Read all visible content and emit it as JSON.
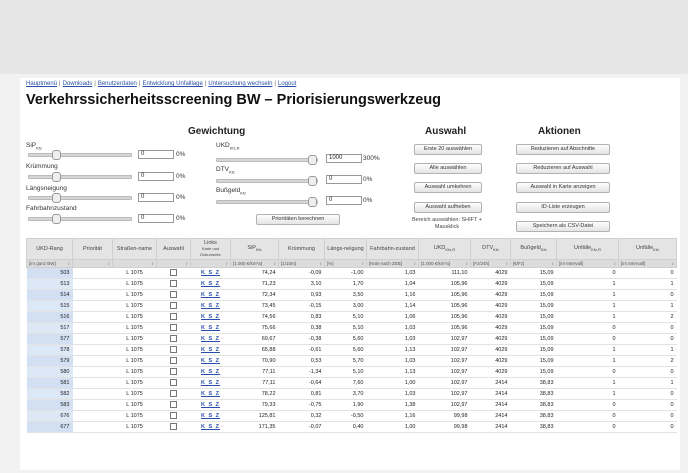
{
  "nav": [
    "Hauptmenü",
    "Downloads",
    "Benutzerdaten",
    "Entwicklung Unfalllage",
    "Untersuchung wechseln",
    "Logout"
  ],
  "title": "Verkehrssicherheitsscreening BW – Priorisierungswerkzeug",
  "gewichtung": {
    "heading": "Gewichtung",
    "items": [
      {
        "label": "SiP",
        "sub": "Kfz",
        "value": "0",
        "pct": "0%",
        "level": 0.0
      },
      {
        "label": "Krümmung",
        "sub": "",
        "value": "0",
        "pct": "0%",
        "level": 0.0
      },
      {
        "label": "Längsneigung",
        "sub": "",
        "value": "0",
        "pct": "0%",
        "level": 0.0
      },
      {
        "label": "Fahrbahnzustand",
        "sub": "",
        "value": "0",
        "pct": "0%",
        "level": 0.0
      },
      {
        "label": "UKD",
        "sub": "Kfz,R",
        "value": "1000",
        "pct": "300%",
        "level": 1.0
      },
      {
        "label": "DTV",
        "sub": "Kfz",
        "value": "0",
        "pct": "0%",
        "level": 0.0
      },
      {
        "label": "Bußgeld",
        "sub": "Kfz",
        "value": "0",
        "pct": "0%",
        "level": 0.0
      }
    ],
    "calc_button": "Prioritäten berechnen"
  },
  "auswahl": {
    "heading": "Auswahl",
    "buttons": [
      "Erste 20 auswählen",
      "Alle auswählen",
      "Auswahl umkehren",
      "Auswahl aufheben"
    ],
    "note": "Bereich auswählen: SHIFT + Mausklick"
  },
  "aktionen": {
    "heading": "Aktionen",
    "buttons": [
      "Reduzieren auf Abschnitte",
      "Reduzieren auf Auswahl",
      "Auswahl in Karte anzeigen",
      "ID-Liste erzeugen",
      "Speichern als CSV-Datei"
    ]
  },
  "table": {
    "headers": [
      "UKD-Rang",
      "Priorität",
      "Straßen-name",
      "Auswahl",
      "Links",
      "SiP",
      "Krümmung",
      "Längs-neigung",
      "Fahrbahn-zustand",
      "UKD",
      "DTV",
      "Bußgeld",
      "Unfälle",
      "Unfälle"
    ],
    "header_subs": [
      "",
      "",
      "",
      "",
      "Karte und Dokumente",
      "Kfz",
      "",
      "",
      "",
      "Kfz,R",
      "Kfz",
      "Kfz",
      "Kfz,R",
      "Kfz"
    ],
    "units": [
      "[im ganz BW]",
      "",
      "",
      "",
      "",
      "[1.000 €/km*a]",
      "[1/10m]",
      "[%]",
      "[Note nach ZEB]",
      "[1.000 €/km*a]",
      "[Fz/24h]",
      "[€/Fz]",
      "[im Intervall]",
      "[im Intervall]"
    ],
    "rows": [
      [
        "503",
        "",
        "L 1075",
        "",
        "K S Z",
        "74,24",
        "-0,09",
        "-1,00",
        "1,03",
        "111,10",
        "4029",
        "15,09",
        "0",
        "0"
      ],
      [
        "513",
        "",
        "L 1075",
        "",
        "K S Z",
        "71,23",
        "3,10",
        "1,70",
        "1,04",
        "105,96",
        "4029",
        "15,09",
        "1",
        "1"
      ],
      [
        "514",
        "",
        "L 1075",
        "",
        "K S Z",
        "72,34",
        "0,93",
        "3,50",
        "1,16",
        "105,96",
        "4029",
        "15,09",
        "1",
        "0"
      ],
      [
        "515",
        "",
        "L 1075",
        "",
        "K S Z",
        "73,45",
        "-0,15",
        "3,00",
        "1,14",
        "105,96",
        "4029",
        "15,09",
        "1",
        "1"
      ],
      [
        "516",
        "",
        "L 1075",
        "",
        "K S Z",
        "74,56",
        "0,83",
        "5,10",
        "1,06",
        "105,96",
        "4029",
        "15,09",
        "1",
        "2"
      ],
      [
        "517",
        "",
        "L 1075",
        "",
        "K S Z",
        "75,66",
        "0,38",
        "5,10",
        "1,03",
        "105,96",
        "4029",
        "15,09",
        "0",
        "0"
      ],
      [
        "577",
        "",
        "L 1075",
        "",
        "K S Z",
        "69,67",
        "-0,38",
        "5,60",
        "1,03",
        "102,97",
        "4029",
        "15,09",
        "0",
        "0"
      ],
      [
        "578",
        "",
        "L 1075",
        "",
        "K S Z",
        "65,88",
        "-0,61",
        "5,60",
        "1,13",
        "102,97",
        "4029",
        "15,09",
        "1",
        "1"
      ],
      [
        "579",
        "",
        "L 1075",
        "",
        "K S Z",
        "70,90",
        "0,53",
        "5,70",
        "1,03",
        "102,97",
        "4029",
        "15,09",
        "1",
        "2"
      ],
      [
        "580",
        "",
        "L 1075",
        "",
        "K S Z",
        "77,11",
        "-1,34",
        "5,10",
        "1,13",
        "102,97",
        "4029",
        "15,09",
        "0",
        "0"
      ],
      [
        "581",
        "",
        "L 1075",
        "",
        "K S Z",
        "77,11",
        "-0,64",
        "7,60",
        "1,00",
        "102,97",
        "2414",
        "38,83",
        "1",
        "1"
      ],
      [
        "582",
        "",
        "L 1075",
        "",
        "K S Z",
        "78,22",
        "0,81",
        "3,70",
        "1,03",
        "102,97",
        "2414",
        "38,83",
        "1",
        "0"
      ],
      [
        "583",
        "",
        "L 1075",
        "",
        "K S Z",
        "79,33",
        "-0,75",
        "1,90",
        "1,38",
        "102,97",
        "2414",
        "38,83",
        "0",
        "0"
      ],
      [
        "676",
        "",
        "L 1075",
        "",
        "K S Z",
        "125,81",
        "0,32",
        "-0,50",
        "1,16",
        "99,98",
        "2414",
        "38,83",
        "0",
        "0"
      ],
      [
        "677",
        "",
        "L 1075",
        "",
        "K S Z",
        "171,35",
        "-0,07",
        "0,40",
        "1,00",
        "99,98",
        "2414",
        "38,83",
        "0",
        "0"
      ]
    ]
  },
  "colors": {
    "link": "#2a4fa8",
    "rank_bg": "#dde8f7"
  }
}
